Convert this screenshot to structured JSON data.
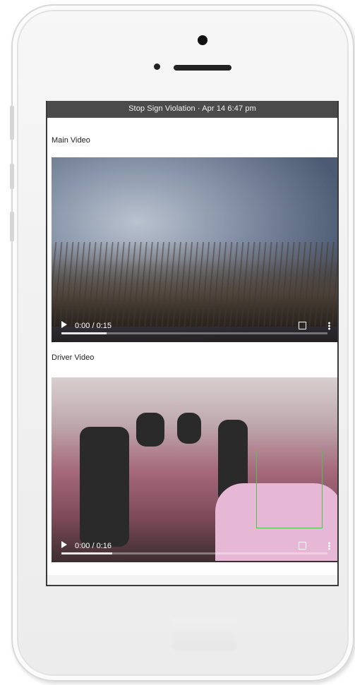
{
  "app": {
    "title": "Stop Sign Violation · Apr 14 6:47 pm"
  },
  "sections": [
    {
      "label": "Main Video",
      "time": "0:00 / 0:15",
      "progress": 0.17
    },
    {
      "label": "Driver Video",
      "time": "0:00 / 0:16",
      "progress": 0.19
    }
  ],
  "icons": {
    "play": "play-icon",
    "fullscreen": "fullscreen-icon",
    "more": "more-vertical-icon"
  },
  "colors": {
    "title_bar": "#4b4b4b",
    "face_box": "#4fc24f"
  }
}
